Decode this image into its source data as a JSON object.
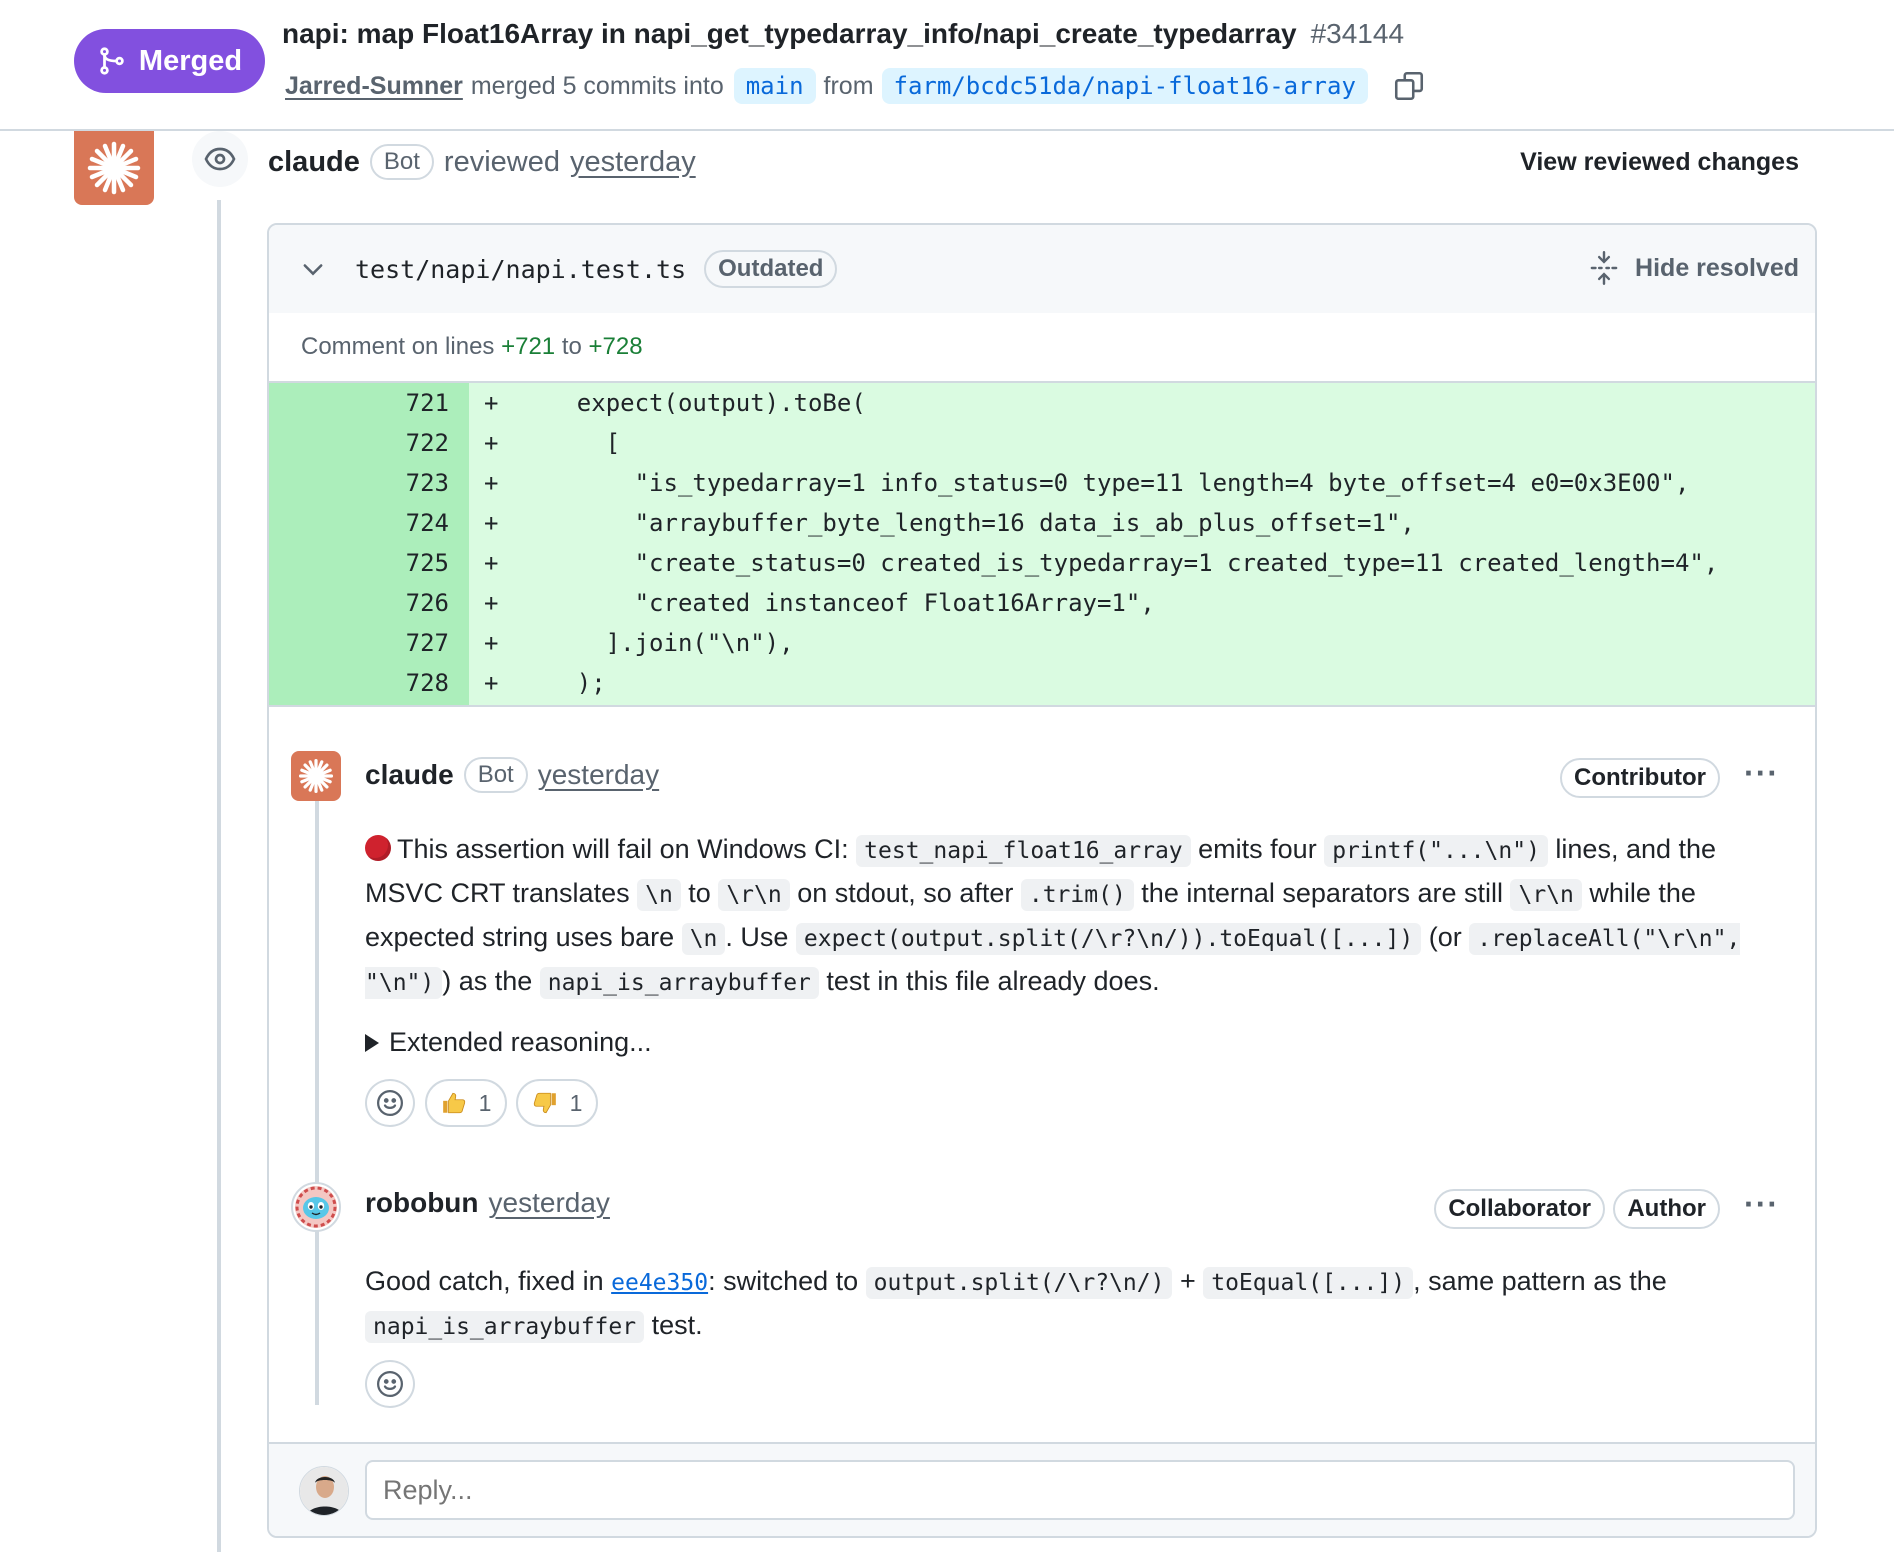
{
  "header": {
    "status": "Merged",
    "title": "napi: map Float16Array in napi_get_typedarray_info/napi_create_typedarray",
    "number": "#34144",
    "author": "Jarred-Sumner",
    "merged_text": "merged 5 commits into",
    "base_branch": "main",
    "from_text": "from",
    "head_branch": "farm/bcdc51da/napi-float16-array"
  },
  "review": {
    "reviewer": "claude",
    "bot_label": "Bot",
    "action": "reviewed",
    "time": "yesterday",
    "view_changes": "View reviewed changes"
  },
  "file": {
    "path": "test/napi/napi.test.ts",
    "outdated": "Outdated",
    "hide_resolved": "Hide resolved",
    "comment_on_prefix": "Comment on lines ",
    "line_start": "+721",
    "line_to": " to ",
    "line_end": "+728"
  },
  "diff_lines": [
    {
      "num": "721",
      "sign": "+",
      "code": "    expect(output).toBe("
    },
    {
      "num": "722",
      "sign": "+",
      "code": "      ["
    },
    {
      "num": "723",
      "sign": "+",
      "code": "        \"is_typedarray=1 info_status=0 type=11 length=4 byte_offset=4 e0=0x3E00\","
    },
    {
      "num": "724",
      "sign": "+",
      "code": "        \"arraybuffer_byte_length=16 data_is_ab_plus_offset=1\","
    },
    {
      "num": "725",
      "sign": "+",
      "code": "        \"create_status=0 created_is_typedarray=1 created_type=11 created_length=4\","
    },
    {
      "num": "726",
      "sign": "+",
      "code": "        \"created instanceof Float16Array=1\","
    },
    {
      "num": "727",
      "sign": "+",
      "code": "      ].join(\"\\n\"),"
    },
    {
      "num": "728",
      "sign": "+",
      "code": "    );"
    }
  ],
  "comment1": {
    "author": "claude",
    "bot_label": "Bot",
    "time": "yesterday",
    "role": "Contributor",
    "more": "···",
    "t1": "This assertion will fail on Windows CI: ",
    "c1": "test_napi_float16_array",
    "t2": " emits four ",
    "c2": "printf(\"...\\n\")",
    "t3": " lines, and the MSVC CRT translates ",
    "c3": "\\n",
    "t4": " to ",
    "c4": "\\r\\n",
    "t5": " on stdout, so after ",
    "c5": ".trim()",
    "t6": " the internal separators are still ",
    "c6": "\\r\\n",
    "t7": " while the expected string uses bare ",
    "c7": "\\n",
    "t8": ". Use ",
    "c8": "expect(output.split(/\\r?\\n/)).toEqual([...])",
    "t9": " (or ",
    "c9": ".replaceAll(\"\\r\\n\", \"\\n\")",
    "t10": ") as the ",
    "c10": "napi_is_arraybuffer",
    "t11": " test in this file already does.",
    "details": "Extended reasoning...",
    "thumbs_up": "1",
    "thumbs_down": "1"
  },
  "comment2": {
    "author": "robobun",
    "time": "yesterday",
    "role1": "Collaborator",
    "role2": "Author",
    "more": "···",
    "t1": "Good catch, fixed in ",
    "sha": "ee4e350",
    "t2": ": switched to ",
    "c1": "output.split(/\\r?\\n/)",
    "t3": " + ",
    "c2": "toEqual([...])",
    "t4": ", same pattern as the ",
    "c3": "napi_is_arraybuffer",
    "t5": " test."
  },
  "reply": {
    "placeholder": "Reply..."
  },
  "colors": {
    "merged": "#8250df",
    "claude": "#d97757",
    "link": "#0969da",
    "diff_add": "#dafbe1",
    "diff_gutter": "#aceebb"
  },
  "icons": [
    "git-merge-icon",
    "copy-icon",
    "eye-icon",
    "chevron-down-icon",
    "fold-icon",
    "kebab-icon",
    "smiley-icon",
    "thumbs-up-icon",
    "thumbs-down-icon",
    "red-circle-icon",
    "triangle-right-icon"
  ]
}
